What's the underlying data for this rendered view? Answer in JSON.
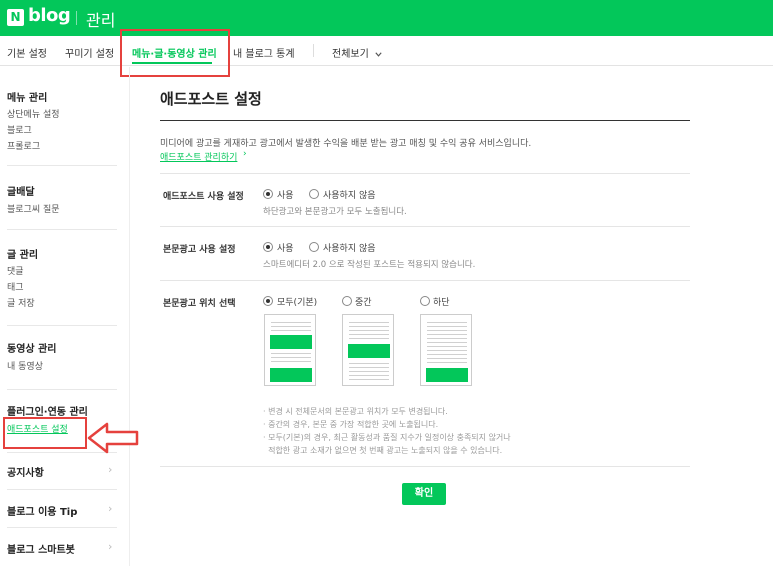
{
  "header": {
    "logo_letter": "N",
    "logo_text": "blog",
    "title": "관리"
  },
  "topnav": {
    "tabs": [
      {
        "label": "기본 설정"
      },
      {
        "label": "꾸미기 설정"
      },
      {
        "label": "메뉴·글·동영상 관리"
      },
      {
        "label": "내 블로그 통계"
      },
      {
        "label": "전체보기"
      }
    ],
    "active_tab": "메뉴·글·동영상 관리",
    "dropdown_icon": "chevron-down-icon"
  },
  "sidebar": {
    "sections": [
      {
        "title": "메뉴 관리",
        "items": [
          "상단메뉴 설정",
          "블로그",
          "프롤로그"
        ]
      },
      {
        "title": "글배달",
        "items": [
          "블로그씨 질문"
        ]
      },
      {
        "title": "글 관리",
        "items": [
          "댓글",
          "태그",
          "글 저장"
        ]
      },
      {
        "title": "동영상 관리",
        "items": [
          "내 동영상"
        ]
      },
      {
        "title": "플러그인·연동 관리",
        "items": [
          "애드포스트 설정"
        ]
      }
    ],
    "links": [
      "공지사항",
      "블로그 이용 Tip",
      "블로그 스마트봇"
    ],
    "active_item": "애드포스트 설정"
  },
  "content": {
    "title": "애드포스트 설정",
    "description": "미디어에 광고를 게재하고 광고에서 발생한 수익을 배분 받는 광고 매칭 및 수익 공유 서비스입니다.",
    "manage_link": "애드포스트 관리하기",
    "rows": [
      {
        "label": "애드포스트 사용 설정",
        "options": [
          "사용",
          "사용하지 않음"
        ],
        "selected": "사용",
        "hint": "하단광고와 본문광고가 모두 노출됩니다."
      },
      {
        "label": "본문광고 사용 설정",
        "options": [
          "사용",
          "사용하지 않음"
        ],
        "selected": "사용",
        "hint": "스마트에디터 2.0 으로 작성된 포스트는 적용되지 않습니다."
      },
      {
        "label": "본문광고 위치 선택",
        "options": [
          "모두(기본)",
          "중간",
          "하단"
        ],
        "selected": "모두(기본)"
      }
    ],
    "notes": [
      "· 변경 시 전체문서의 본문광고 위치가 모두 변경됩니다.",
      "· 중간의 경우, 본문 중 가장 적합한 곳에 노출됩니다.",
      "· 모두(기본)의 경우, 최근 활동성과 품질 지수가 일정이상 충족되지 않거나",
      "  적합한 광고 소재가 없으면 첫 번째 광고는 노출되지 않을 수 있습니다."
    ],
    "confirm_label": "확인"
  },
  "colors": {
    "brand": "#03c75a",
    "highlight": "#e5413d"
  }
}
